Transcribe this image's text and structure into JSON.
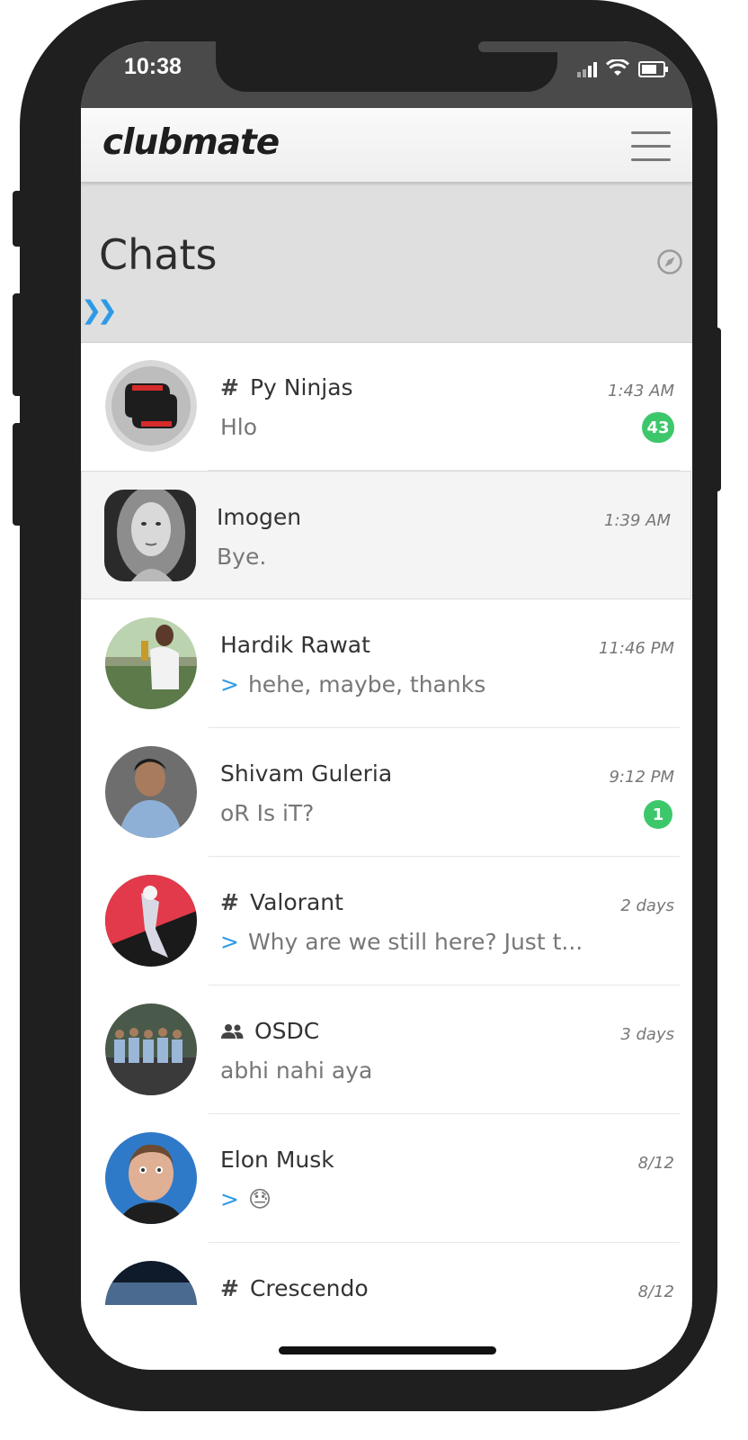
{
  "status_bar": {
    "time": "10:38"
  },
  "app": {
    "logo": "clubmate"
  },
  "page": {
    "title": "Chats",
    "expand_icon": "double-chevron-right"
  },
  "colors": {
    "accent": "#2e9ae6",
    "badge": "#3dc76b"
  },
  "chats": [
    {
      "name": "Py Ninjas",
      "is_channel": true,
      "preview": "Hlo",
      "time": "1:43 AM",
      "unread": "43"
    },
    {
      "name": "Imogen",
      "preview": "Bye.",
      "time": "1:39 AM",
      "selected": true
    },
    {
      "name": "Hardik Rawat",
      "preview": "hehe, maybe, thanks",
      "sent": true,
      "time": "11:46 PM"
    },
    {
      "name": "Shivam Guleria",
      "preview": "oR Is iT?",
      "time": "9:12 PM",
      "unread": "1"
    },
    {
      "name": "Valorant",
      "is_channel": true,
      "preview": "Why are we still here? Just t...",
      "sent": true,
      "time": "2 days"
    },
    {
      "name": "OSDC",
      "is_group": true,
      "preview": "abhi nahi aya",
      "time": "3 days"
    },
    {
      "name": "Elon Musk",
      "preview": "😓",
      "sent": true,
      "time": "8/12"
    },
    {
      "name": "Crescendo",
      "is_channel": true,
      "preview": "",
      "time": "8/12"
    }
  ]
}
